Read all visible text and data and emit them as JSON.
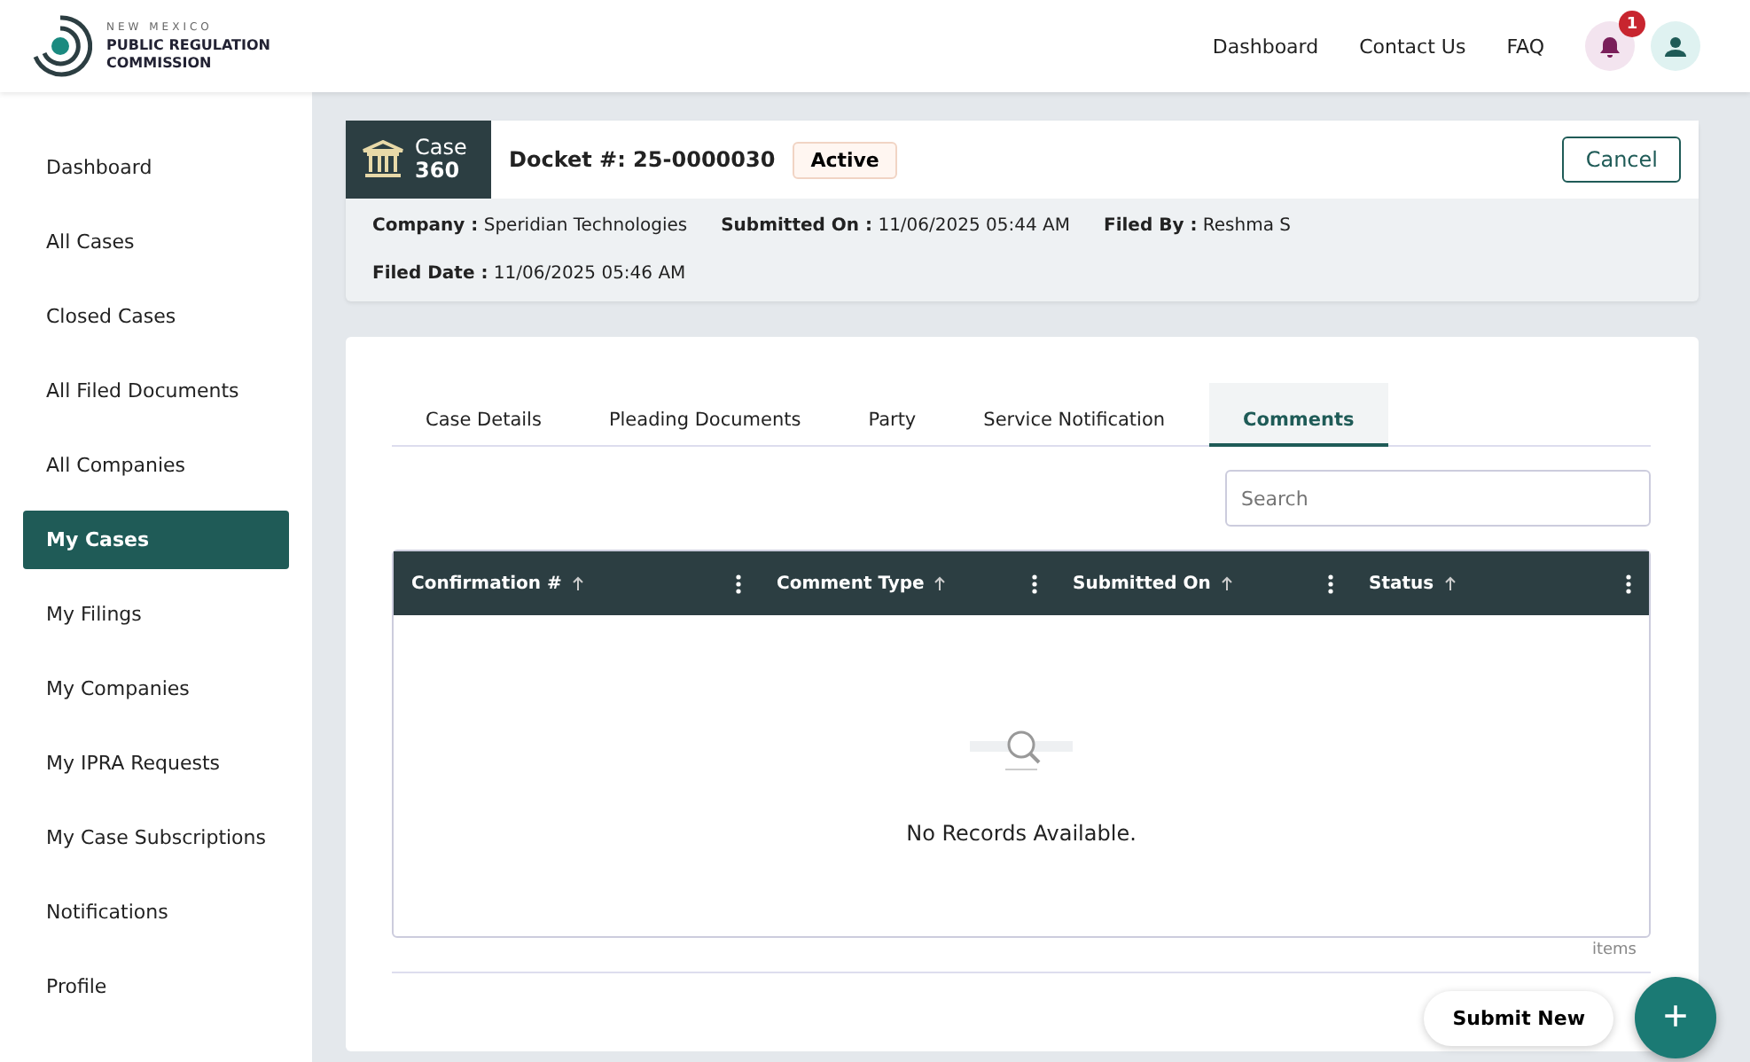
{
  "header": {
    "logo": {
      "line_1": "NEW MEXICO",
      "line_2": "PUBLIC REGULATION",
      "line_3": "COMMISSION"
    },
    "nav": [
      "Dashboard",
      "Contact Us",
      "FAQ"
    ],
    "notification_count": "1"
  },
  "sidebar": {
    "items": [
      {
        "label": "Dashboard",
        "selected": false
      },
      {
        "label": "All Cases",
        "selected": false
      },
      {
        "label": "Closed Cases",
        "selected": false
      },
      {
        "label": "All Filed Documents",
        "selected": false
      },
      {
        "label": "All Companies",
        "selected": false
      },
      {
        "label": "My Cases",
        "selected": true
      },
      {
        "label": "My Filings",
        "selected": false
      },
      {
        "label": "My Companies",
        "selected": false
      },
      {
        "label": "My IPRA Requests",
        "selected": false
      },
      {
        "label": "My Case Subscriptions",
        "selected": false
      },
      {
        "label": "Notifications",
        "selected": false
      },
      {
        "label": "Profile",
        "selected": false
      }
    ]
  },
  "case": {
    "badge_line_1": "Case",
    "badge_line_2": "360",
    "docket": "Docket #: 25-0000030",
    "status": "Active",
    "cancel": "Cancel",
    "fields": [
      {
        "label": "Company :",
        "value": "Speridian Technologies"
      },
      {
        "label": "Submitted On :",
        "value": "11/06/2025 05:44 AM"
      },
      {
        "label": "Filed By :",
        "value": "Reshma S"
      },
      {
        "label": "Filed Date :",
        "value": "11/06/2025 05:46 AM"
      }
    ]
  },
  "tabs": [
    {
      "label": "Case Details",
      "selected": false
    },
    {
      "label": "Pleading Documents",
      "selected": false
    },
    {
      "label": "Party",
      "selected": false
    },
    {
      "label": "Service Notification",
      "selected": false
    },
    {
      "label": "Comments",
      "selected": true
    }
  ],
  "search": {
    "placeholder": "Search"
  },
  "table": {
    "columns": [
      "Confirmation #",
      "Comment Type",
      "Submitted On",
      "Status"
    ],
    "empty_message": "No Records Available."
  },
  "pager": "items",
  "submit_new": "Submit New",
  "fab": "+"
}
